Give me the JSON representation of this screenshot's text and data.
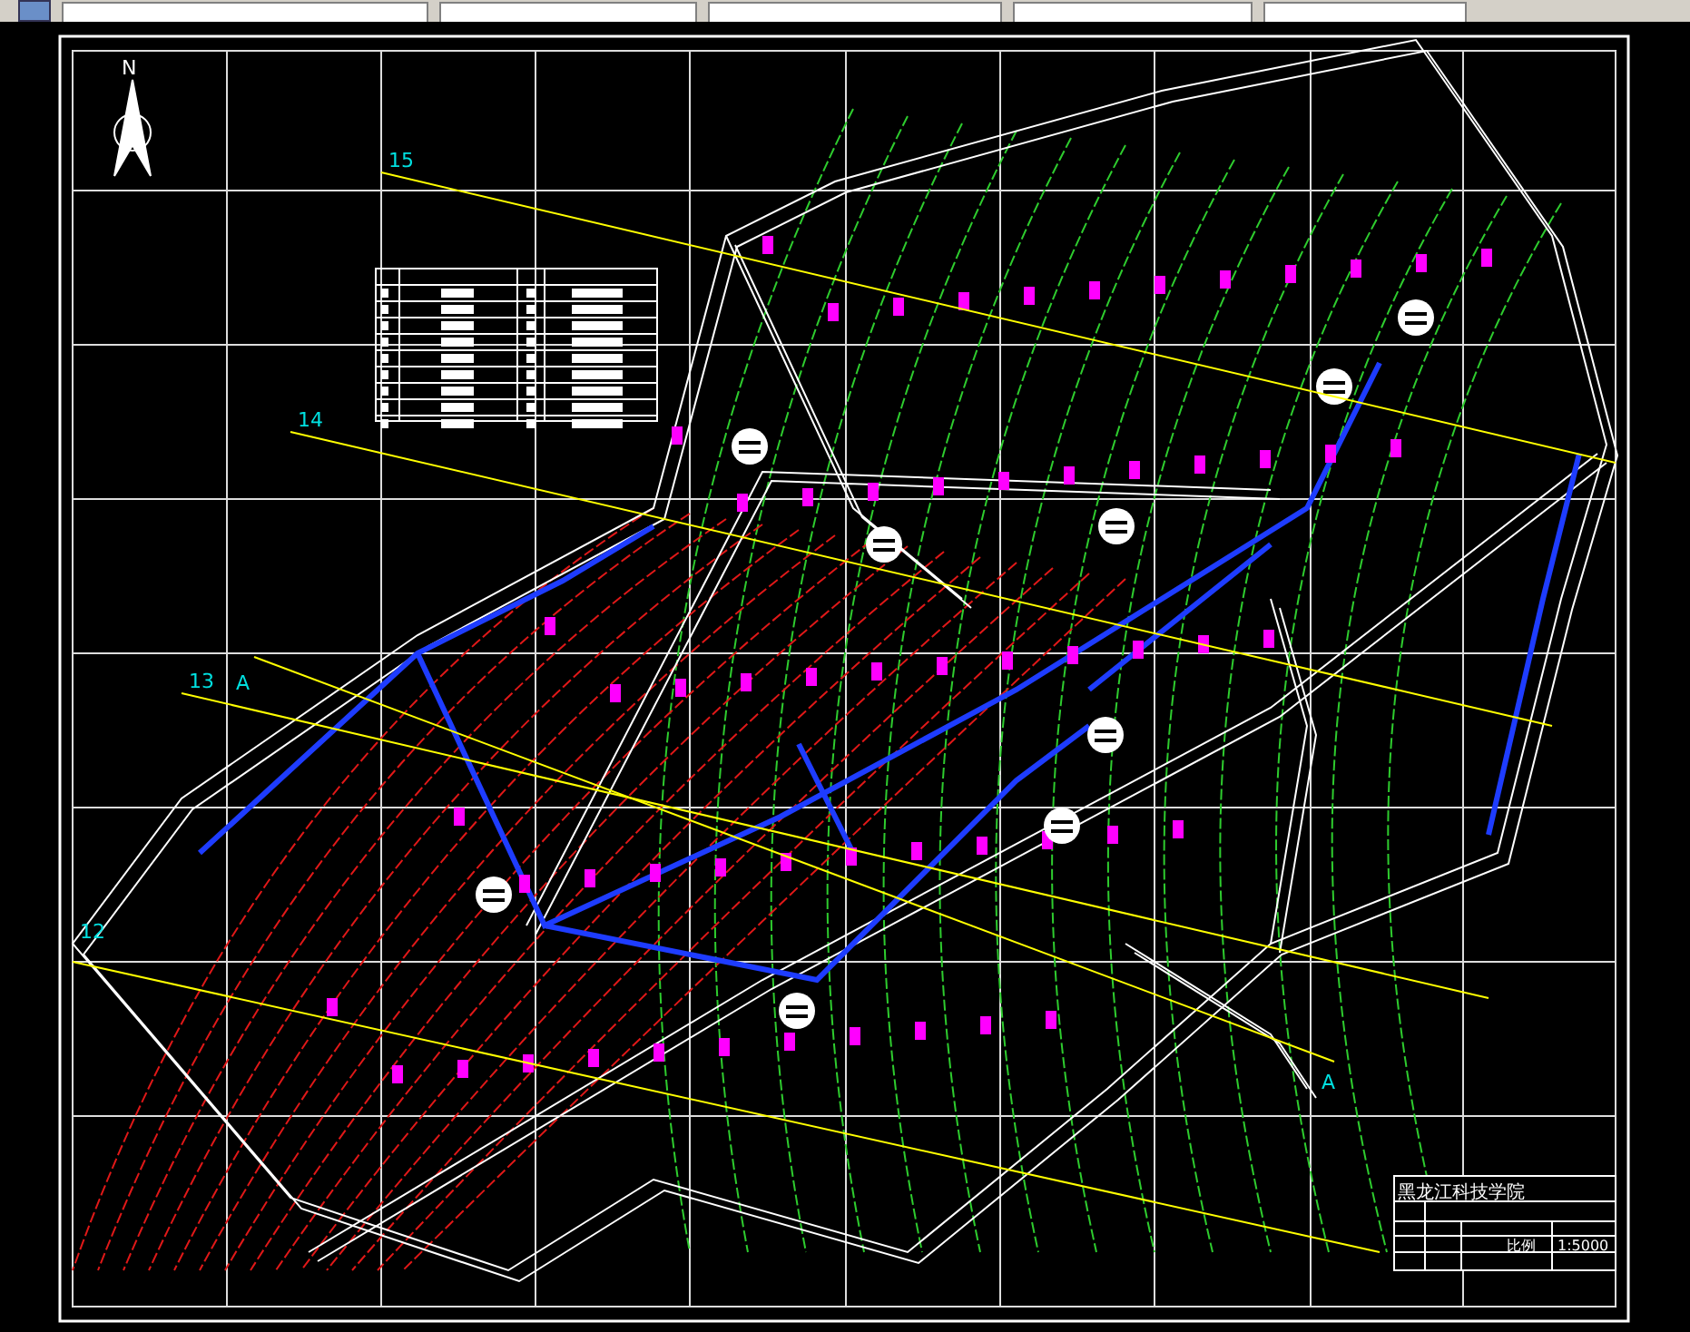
{
  "drawing": {
    "north_label": "N",
    "section_lines": [
      {
        "label": "15"
      },
      {
        "label": "14"
      },
      {
        "label": "13"
      },
      {
        "label": "12"
      }
    ],
    "profile_labels": [
      "A",
      "A"
    ],
    "title_block": {
      "institution": "黑龙江科技学院",
      "scale_label": "比例",
      "scale": "1:5000"
    }
  }
}
